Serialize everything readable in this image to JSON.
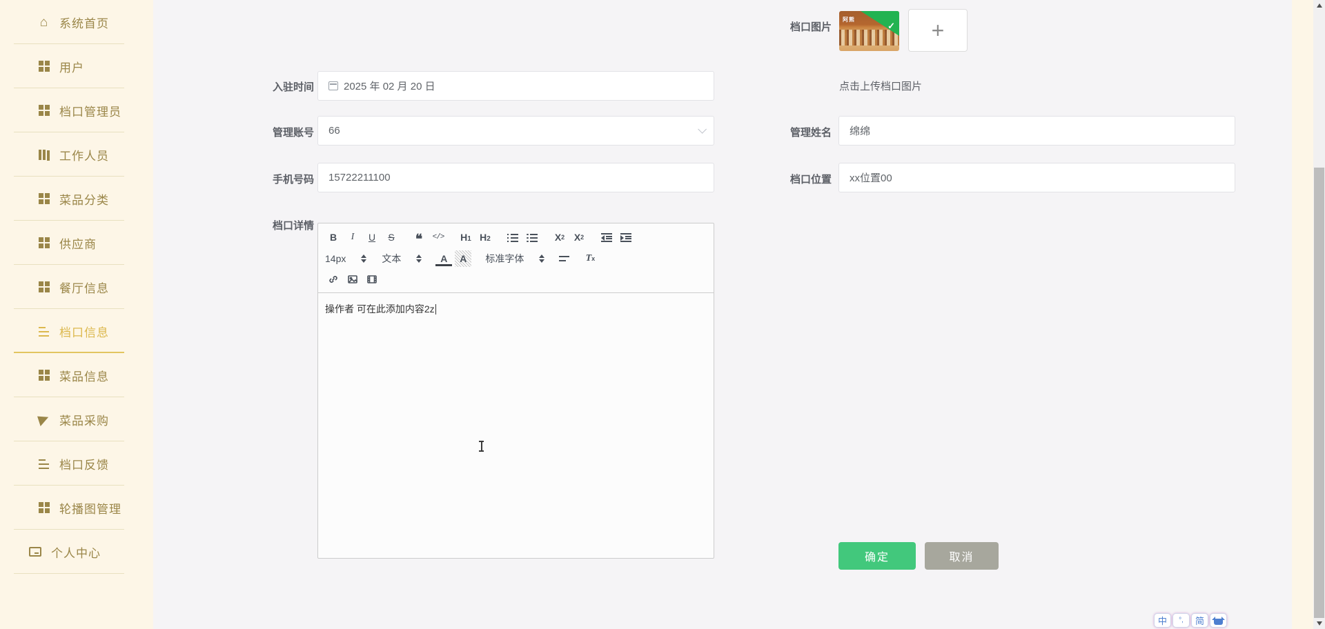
{
  "colors": {
    "sidebar_bg": "#fdf6e7",
    "sidebar_text": "#9a8648",
    "sidebar_active": "#dcb84d",
    "main_bg": "#f5f4f6",
    "confirm_green": "#42c87c",
    "cancel_gray": "#a7a79d",
    "thumb_badge_green": "#22b351",
    "ime_blue": "#4d7fd0"
  },
  "sidebar": {
    "items": [
      {
        "label": "系统首页",
        "icon": "home-icon",
        "active": false
      },
      {
        "label": "用户",
        "icon": "grid-icon",
        "active": false
      },
      {
        "label": "档口管理员",
        "icon": "grid-icon",
        "active": false
      },
      {
        "label": "工作人员",
        "icon": "library-icon",
        "active": false
      },
      {
        "label": "菜品分类",
        "icon": "grid-icon",
        "active": false
      },
      {
        "label": "供应商",
        "icon": "grid-icon",
        "active": false
      },
      {
        "label": "餐厅信息",
        "icon": "grid-icon",
        "active": false
      },
      {
        "label": "档口信息",
        "icon": "list-icon",
        "active": true
      },
      {
        "label": "菜品信息",
        "icon": "grid-icon",
        "active": false
      },
      {
        "label": "菜品采购",
        "icon": "paper-plane-icon",
        "active": false
      },
      {
        "label": "档口反馈",
        "icon": "list-icon",
        "active": false
      },
      {
        "label": "轮播图管理",
        "icon": "grid-icon",
        "active": false
      },
      {
        "label": "个人中心",
        "icon": "card-icon",
        "active": false
      }
    ],
    "home_glyph": "⌂"
  },
  "form": {
    "photo": {
      "label": "档口图片",
      "hint": "点击上传档口图片",
      "thumbnail_sign": "阿熊",
      "check_glyph": "✓",
      "add_glyph": "+"
    },
    "fields": {
      "join_time": {
        "label": "入驻时间",
        "value": "2025 年 02 月 20 日"
      },
      "admin_account": {
        "label": "管理账号",
        "value": "66"
      },
      "admin_name": {
        "label": "管理姓名",
        "value": "绵绵"
      },
      "phone": {
        "label": "手机号码",
        "value": "15722211100"
      },
      "booth_location": {
        "label": "档口位置",
        "value": "xx位置00"
      },
      "booth_detail": {
        "label": "档口详情"
      }
    },
    "buttons": {
      "confirm": "确定",
      "cancel": "取消"
    }
  },
  "editor": {
    "content": "操作者 可在此添加内容2z",
    "toolbar": {
      "bold": "B",
      "italic": "I",
      "underline": "U",
      "strike": "S",
      "quote": "❝",
      "code": "</>",
      "h1": "H",
      "h1_num": "1",
      "h2": "H",
      "h2_num": "2",
      "sub_base": "X",
      "sub_num": "2",
      "sup_base": "X",
      "sup_num": "2",
      "size_value": "14px",
      "text_style_value": "文本",
      "color_letter": "A",
      "bg_letter": "A",
      "font_value": "标准字体",
      "clear_letter": "T",
      "clear_sub": "x"
    }
  },
  "ime": {
    "lang": "中",
    "punct": "°,",
    "simplified": "简"
  }
}
